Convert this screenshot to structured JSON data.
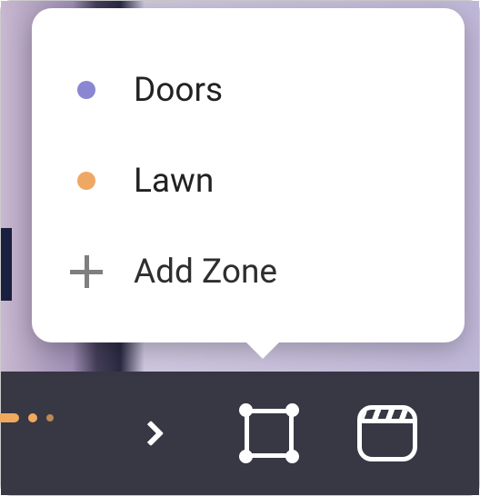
{
  "popover": {
    "zones": [
      {
        "label": "Doors",
        "color": "#8a87d2"
      },
      {
        "label": "Lawn",
        "color": "#eea864"
      }
    ],
    "add_label": "Add Zone"
  }
}
